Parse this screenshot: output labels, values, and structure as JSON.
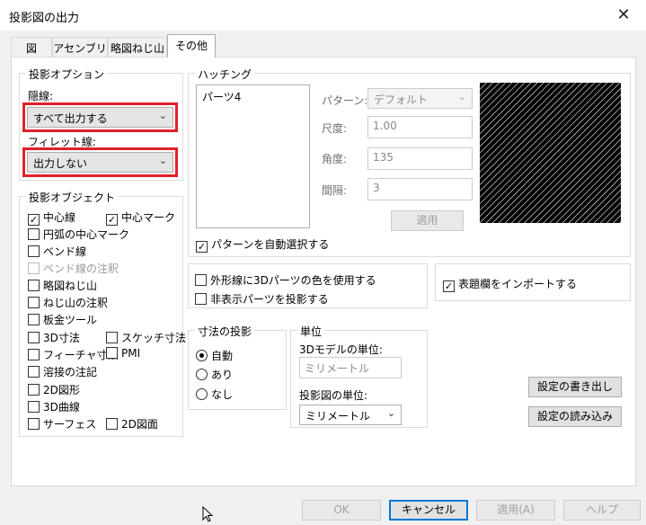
{
  "window": {
    "title": "投影図の出力",
    "close_icon": "close-icon"
  },
  "tabs": [
    {
      "label": "図"
    },
    {
      "label": "アセンブリ"
    },
    {
      "label": "略図ねじ山"
    },
    {
      "label": "その他",
      "active": true
    }
  ],
  "projection_options": {
    "legend": "投影オプション",
    "hidden_lines_label": "隠線:",
    "hidden_lines_value": "すべて出力する",
    "fillet_lines_label": "フィレット線:",
    "fillet_lines_value": "出力しない"
  },
  "projection_objects": {
    "legend": "投影オブジェクト",
    "items": [
      {
        "label": "中心線",
        "checked": true
      },
      {
        "label": "中心マーク",
        "checked": true
      },
      {
        "label": "円弧の中心マーク",
        "checked": false
      },
      {
        "label": "ベンド線",
        "checked": false
      },
      {
        "label": "ベンド線の注釈",
        "checked": false,
        "disabled": true
      },
      {
        "label": "略図ねじ山",
        "checked": false
      },
      {
        "label": "ねじ山の注釈",
        "checked": false
      },
      {
        "label": "板金ツール",
        "checked": false
      },
      {
        "label": "3D寸法",
        "checked": false
      },
      {
        "label": "スケッチ寸法",
        "checked": false
      },
      {
        "label": "フィーチャ寸法",
        "checked": false
      },
      {
        "label": "PMI",
        "checked": false
      },
      {
        "label": "溶接の注記",
        "checked": false
      },
      {
        "label": "2D図形",
        "checked": false
      },
      {
        "label": "3D曲線",
        "checked": false
      },
      {
        "label": "サーフェス",
        "checked": false
      },
      {
        "label": "2D図面",
        "checked": false
      }
    ]
  },
  "hatching": {
    "legend": "ハッチング",
    "list_items": [
      "パーツ4"
    ],
    "pattern_label": "パターン:",
    "pattern_value": "デフォルト",
    "scale_label": "尺度:",
    "scale_value": "1.00",
    "angle_label": "角度:",
    "angle_value": "135",
    "spacing_label": "間隔:",
    "spacing_value": "3",
    "apply_label": "適用",
    "auto_select_label": "パターンを自動選択する",
    "auto_select_checked": true
  },
  "part_options": {
    "outline_color_label": "外形線に3Dパーツの色を使用する",
    "project_hidden_label": "非表示パーツを投影する",
    "import_title_block_label": "表題欄をインポートする"
  },
  "dimension_projection": {
    "legend": "寸法の投影",
    "options": [
      "自動",
      "あり",
      "なし"
    ],
    "selected": "自動"
  },
  "units": {
    "legend": "単位",
    "model_units_label": "3Dモデルの単位:",
    "model_units_value": "ミリメートル",
    "drawing_units_label": "投影図の単位:",
    "drawing_units_value": "ミリメートル"
  },
  "settings_buttons": {
    "export_label": "設定の書き出し",
    "import_label": "設定の読み込み"
  },
  "footer": {
    "ok_label": "OK",
    "cancel_label": "キャンセル",
    "apply_label": "適用(A)",
    "help_label": "ヘルプ"
  }
}
